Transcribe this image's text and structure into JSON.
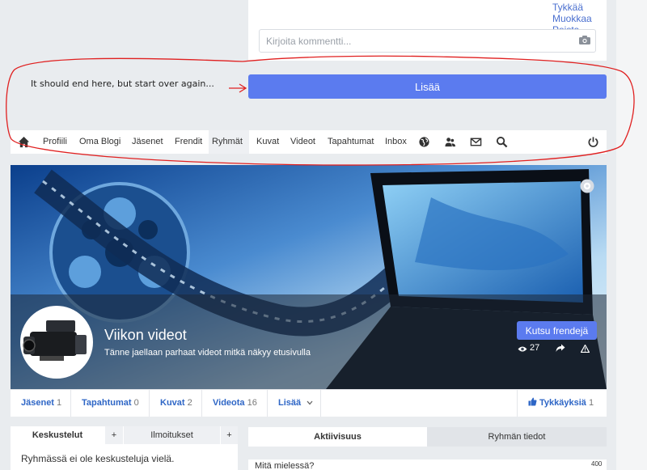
{
  "post": {
    "actions": [
      "Tykkää",
      "Muokkaa",
      "Poista"
    ],
    "comment_placeholder": "Kirjoita kommentti...",
    "submit_label": "Lisää"
  },
  "annotation": {
    "note": "It should end here, but start over again...",
    "color": "#e02020"
  },
  "nav": {
    "items": [
      "Profiili",
      "Oma Blogi",
      "Jäsenet",
      "Frendit",
      "Ryhmät",
      "Kuvat",
      "Videot",
      "Tapahtumat",
      "Inbox"
    ],
    "active": "Ryhmät",
    "icons": [
      "home-icon",
      "globe-icon",
      "friends-icon",
      "mail-icon",
      "search-icon",
      "power-icon"
    ]
  },
  "group": {
    "title": "Viikon videot",
    "description": "Tänne jaellaan parhaat videot mitkä näkyy etusivulla",
    "invite_label": "Kutsu frendejä",
    "views": "27",
    "icons": [
      "settings-icon",
      "eye-icon",
      "share-icon",
      "warning-icon"
    ]
  },
  "tabs": [
    {
      "label": "Jäsenet",
      "count": "1"
    },
    {
      "label": "Tapahtumat",
      "count": "0"
    },
    {
      "label": "Kuvat",
      "count": "2"
    },
    {
      "label": "Videota",
      "count": "16"
    },
    {
      "label": "Lisää",
      "count": ""
    }
  ],
  "likes": {
    "label": "Tykkäyksiä",
    "count": "1"
  },
  "left_panel": {
    "tabs": [
      "Keskustelut",
      "+",
      "Ilmoitukset",
      "+"
    ],
    "empty_text": "Ryhmässä ei ole keskusteluja vielä."
  },
  "right_panel": {
    "tabs": [
      "Aktiivisuus",
      "Ryhmän tiedot"
    ],
    "status_placeholder": "Mitä mielessä?",
    "char_limit": "400"
  },
  "colors": {
    "accent": "#5b7bef",
    "link": "#2e66c6",
    "background": "#e9ecef"
  }
}
